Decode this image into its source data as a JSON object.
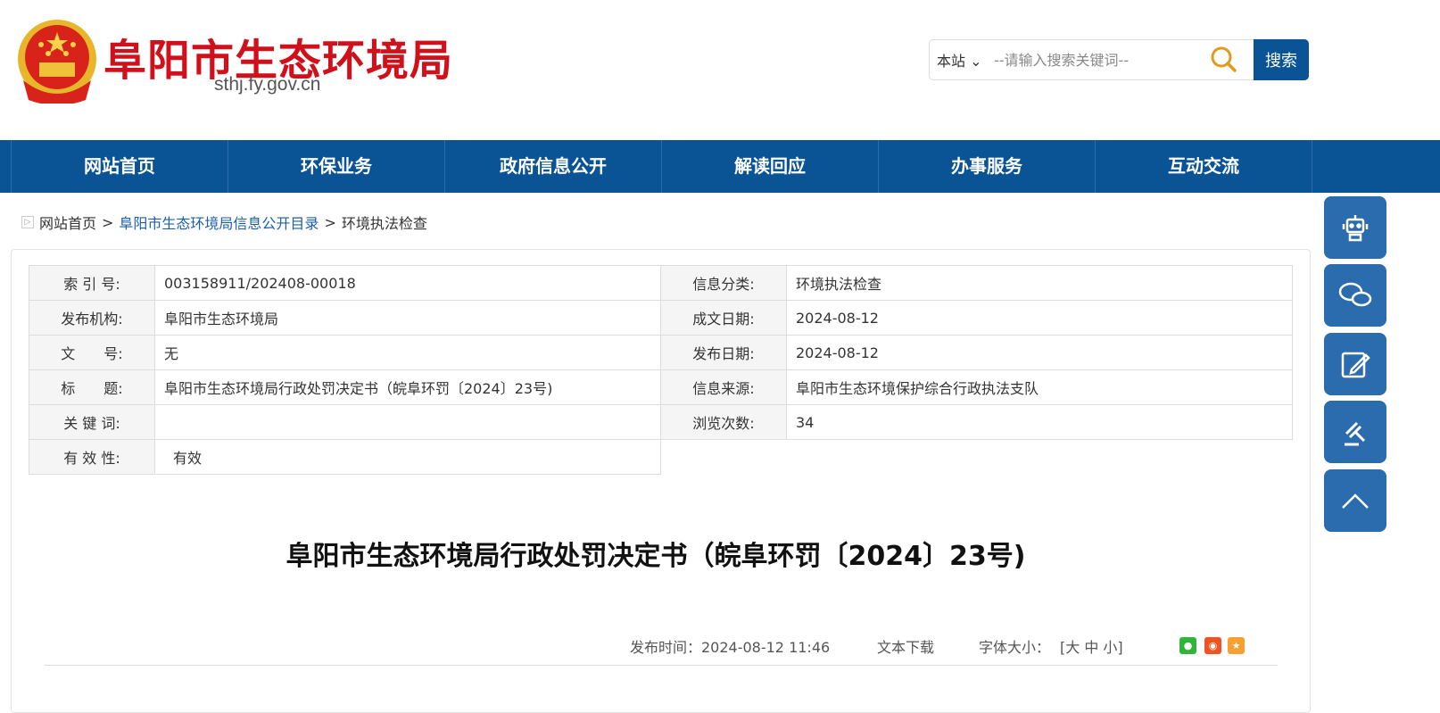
{
  "header": {
    "site_title": "阜阳市生态环境局",
    "site_url": "sthj.fy.gov.cn"
  },
  "search": {
    "scope": "本站",
    "placeholder": "--请输入搜索关键词--",
    "button": "搜索"
  },
  "nav": [
    "网站首页",
    "环保业务",
    "政府信息公开",
    "解读回应",
    "办事服务",
    "互动交流"
  ],
  "breadcrumb": {
    "home": "网站首页",
    "sep": ">",
    "catalog": "阜阳市生态环境局信息公开目录",
    "current": "环境执法检查"
  },
  "info": {
    "rows": [
      [
        {
          "label": "索 引 号:",
          "value": "003158911/202408-00018"
        },
        {
          "label": "信息分类:",
          "value": "环境执法检查"
        }
      ],
      [
        {
          "label": "发布机构:",
          "value": "阜阳市生态环境局"
        },
        {
          "label": "成文日期:",
          "value": "2024-08-12"
        }
      ],
      [
        {
          "label": "文　　号:",
          "value": "无"
        },
        {
          "label": "发布日期:",
          "value": "2024-08-12"
        }
      ],
      [
        {
          "label": "标　　题:",
          "value": "阜阳市生态环境局行政处罚决定书（皖阜环罚〔2024〕23号)"
        },
        {
          "label": "信息来源:",
          "value": "阜阳市生态环境保护综合行政执法支队"
        }
      ],
      [
        {
          "label": "关 键 词:",
          "value": ""
        },
        {
          "label": "浏览次数:",
          "value": "34"
        }
      ]
    ],
    "validity": {
      "label": "有 效 性:",
      "value": "有效"
    }
  },
  "article": {
    "title": "阜阳市生态环境局行政处罚决定书（皖阜环罚〔2024〕23号)",
    "publish_time": "发布时间：2024-08-12 11:46",
    "download": "文本下载",
    "font_size_label": "字体大小：",
    "font_sizes": "[大 中 小]"
  },
  "colors": {
    "brand": "#0a5394",
    "title_red": "#d0101a",
    "float": "#2b6cae"
  }
}
